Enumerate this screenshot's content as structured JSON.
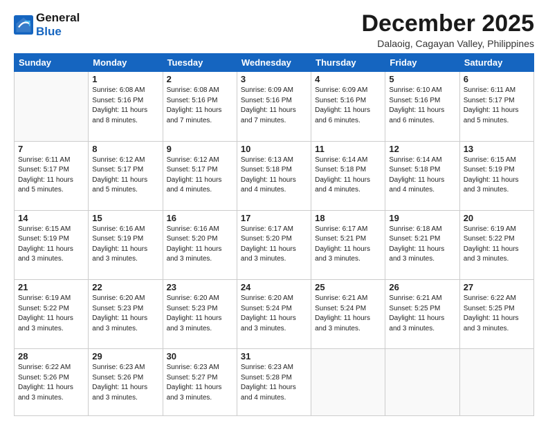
{
  "logo": {
    "line1": "General",
    "line2": "Blue"
  },
  "title": "December 2025",
  "location": "Dalaoig, Cagayan Valley, Philippines",
  "weekdays": [
    "Sunday",
    "Monday",
    "Tuesday",
    "Wednesday",
    "Thursday",
    "Friday",
    "Saturday"
  ],
  "weeks": [
    [
      {
        "day": "",
        "info": ""
      },
      {
        "day": "1",
        "info": "Sunrise: 6:08 AM\nSunset: 5:16 PM\nDaylight: 11 hours\nand 8 minutes."
      },
      {
        "day": "2",
        "info": "Sunrise: 6:08 AM\nSunset: 5:16 PM\nDaylight: 11 hours\nand 7 minutes."
      },
      {
        "day": "3",
        "info": "Sunrise: 6:09 AM\nSunset: 5:16 PM\nDaylight: 11 hours\nand 7 minutes."
      },
      {
        "day": "4",
        "info": "Sunrise: 6:09 AM\nSunset: 5:16 PM\nDaylight: 11 hours\nand 6 minutes."
      },
      {
        "day": "5",
        "info": "Sunrise: 6:10 AM\nSunset: 5:16 PM\nDaylight: 11 hours\nand 6 minutes."
      },
      {
        "day": "6",
        "info": "Sunrise: 6:11 AM\nSunset: 5:17 PM\nDaylight: 11 hours\nand 5 minutes."
      }
    ],
    [
      {
        "day": "7",
        "info": "Sunrise: 6:11 AM\nSunset: 5:17 PM\nDaylight: 11 hours\nand 5 minutes."
      },
      {
        "day": "8",
        "info": "Sunrise: 6:12 AM\nSunset: 5:17 PM\nDaylight: 11 hours\nand 5 minutes."
      },
      {
        "day": "9",
        "info": "Sunrise: 6:12 AM\nSunset: 5:17 PM\nDaylight: 11 hours\nand 4 minutes."
      },
      {
        "day": "10",
        "info": "Sunrise: 6:13 AM\nSunset: 5:18 PM\nDaylight: 11 hours\nand 4 minutes."
      },
      {
        "day": "11",
        "info": "Sunrise: 6:14 AM\nSunset: 5:18 PM\nDaylight: 11 hours\nand 4 minutes."
      },
      {
        "day": "12",
        "info": "Sunrise: 6:14 AM\nSunset: 5:18 PM\nDaylight: 11 hours\nand 4 minutes."
      },
      {
        "day": "13",
        "info": "Sunrise: 6:15 AM\nSunset: 5:19 PM\nDaylight: 11 hours\nand 3 minutes."
      }
    ],
    [
      {
        "day": "14",
        "info": "Sunrise: 6:15 AM\nSunset: 5:19 PM\nDaylight: 11 hours\nand 3 minutes."
      },
      {
        "day": "15",
        "info": "Sunrise: 6:16 AM\nSunset: 5:19 PM\nDaylight: 11 hours\nand 3 minutes."
      },
      {
        "day": "16",
        "info": "Sunrise: 6:16 AM\nSunset: 5:20 PM\nDaylight: 11 hours\nand 3 minutes."
      },
      {
        "day": "17",
        "info": "Sunrise: 6:17 AM\nSunset: 5:20 PM\nDaylight: 11 hours\nand 3 minutes."
      },
      {
        "day": "18",
        "info": "Sunrise: 6:17 AM\nSunset: 5:21 PM\nDaylight: 11 hours\nand 3 minutes."
      },
      {
        "day": "19",
        "info": "Sunrise: 6:18 AM\nSunset: 5:21 PM\nDaylight: 11 hours\nand 3 minutes."
      },
      {
        "day": "20",
        "info": "Sunrise: 6:19 AM\nSunset: 5:22 PM\nDaylight: 11 hours\nand 3 minutes."
      }
    ],
    [
      {
        "day": "21",
        "info": "Sunrise: 6:19 AM\nSunset: 5:22 PM\nDaylight: 11 hours\nand 3 minutes."
      },
      {
        "day": "22",
        "info": "Sunrise: 6:20 AM\nSunset: 5:23 PM\nDaylight: 11 hours\nand 3 minutes."
      },
      {
        "day": "23",
        "info": "Sunrise: 6:20 AM\nSunset: 5:23 PM\nDaylight: 11 hours\nand 3 minutes."
      },
      {
        "day": "24",
        "info": "Sunrise: 6:20 AM\nSunset: 5:24 PM\nDaylight: 11 hours\nand 3 minutes."
      },
      {
        "day": "25",
        "info": "Sunrise: 6:21 AM\nSunset: 5:24 PM\nDaylight: 11 hours\nand 3 minutes."
      },
      {
        "day": "26",
        "info": "Sunrise: 6:21 AM\nSunset: 5:25 PM\nDaylight: 11 hours\nand 3 minutes."
      },
      {
        "day": "27",
        "info": "Sunrise: 6:22 AM\nSunset: 5:25 PM\nDaylight: 11 hours\nand 3 minutes."
      }
    ],
    [
      {
        "day": "28",
        "info": "Sunrise: 6:22 AM\nSunset: 5:26 PM\nDaylight: 11 hours\nand 3 minutes."
      },
      {
        "day": "29",
        "info": "Sunrise: 6:23 AM\nSunset: 5:26 PM\nDaylight: 11 hours\nand 3 minutes."
      },
      {
        "day": "30",
        "info": "Sunrise: 6:23 AM\nSunset: 5:27 PM\nDaylight: 11 hours\nand 3 minutes."
      },
      {
        "day": "31",
        "info": "Sunrise: 6:23 AM\nSunset: 5:28 PM\nDaylight: 11 hours\nand 4 minutes."
      },
      {
        "day": "",
        "info": ""
      },
      {
        "day": "",
        "info": ""
      },
      {
        "day": "",
        "info": ""
      }
    ]
  ]
}
